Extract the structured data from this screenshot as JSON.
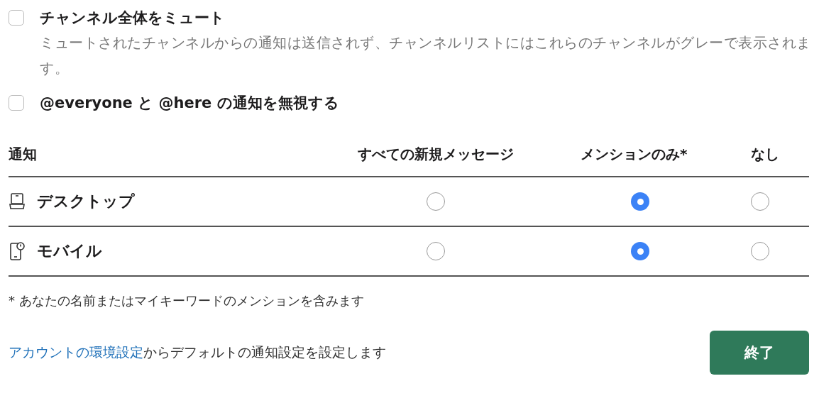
{
  "options": [
    {
      "label": "チャンネル全体をミュート",
      "description": "ミュートされたチャンネルからの通知は送信されず、チャンネルリストにはこれらのチャンネルがグレーで表示されます。",
      "checked": false
    },
    {
      "label": "@everyone と @here の通知を無視する",
      "checked": false
    }
  ],
  "table": {
    "columns": [
      "通知",
      "すべての新規メッセージ",
      "メンションのみ*",
      "なし"
    ],
    "rows": [
      {
        "kind": "desktop",
        "label": "デスクトップ",
        "choices": [
          {
            "selected": false
          },
          {
            "selected": true
          },
          {
            "selected": false
          }
        ]
      },
      {
        "kind": "mobile",
        "label": "モバイル",
        "choices": [
          {
            "selected": false
          },
          {
            "selected": true
          },
          {
            "selected": false
          }
        ]
      }
    ]
  },
  "footnote": "* あなたの名前またはマイキーワードのメンションを含みます",
  "footer": {
    "link": "アカウントの環境設定",
    "text": "からデフォルトの通知設定を設定します",
    "button": "終了"
  }
}
